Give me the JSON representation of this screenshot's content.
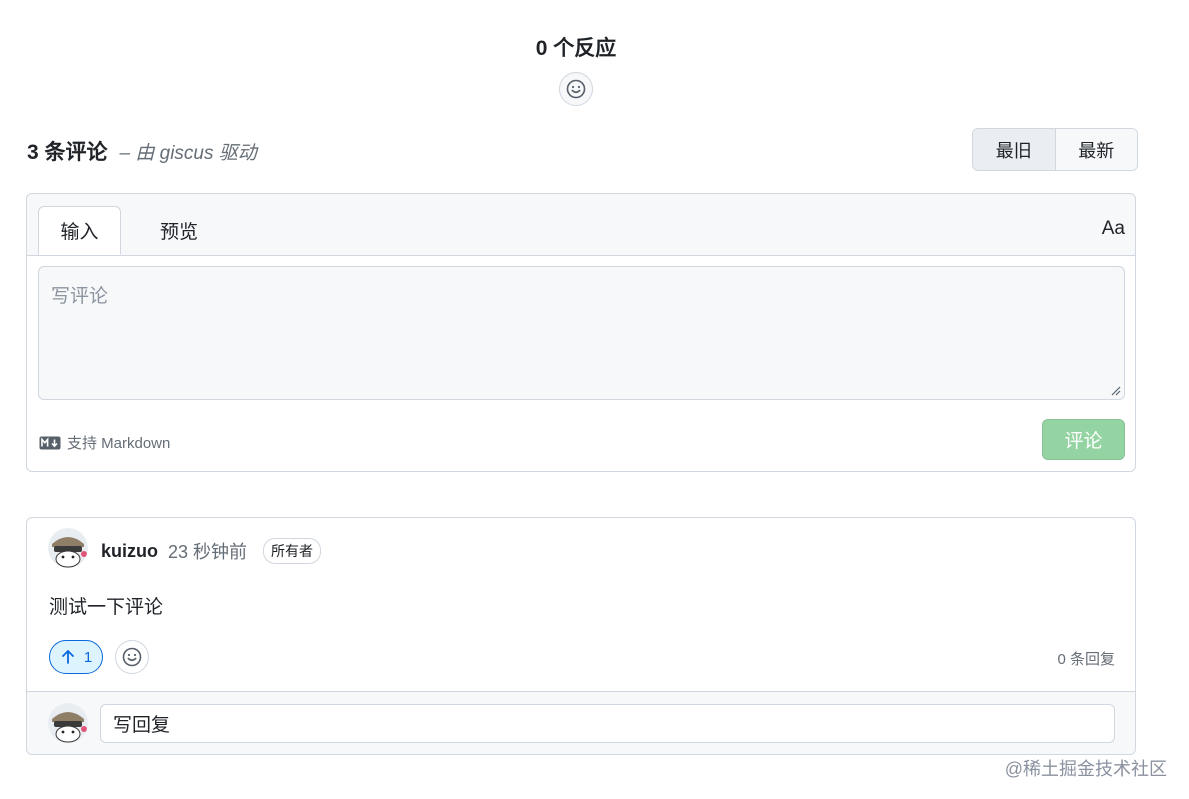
{
  "reactions": {
    "title": "0 个反应",
    "add_icon": "smiley-icon"
  },
  "comments_header": {
    "count_label": "3 条评论",
    "powered_by": "– 由 giscus 驱动"
  },
  "sort": {
    "oldest": "最旧",
    "newest": "最新",
    "active": "oldest"
  },
  "editor": {
    "tab_write": "输入",
    "tab_preview": "预览",
    "font_toggle": "Aa",
    "placeholder": "写评论",
    "markdown_note": "支持 Markdown",
    "submit_label": "评论",
    "submit_color": "#94d3a2"
  },
  "comment": {
    "author": "kuizuo",
    "time": "23 秒钟前",
    "badge": "所有者",
    "body": "测试一下评论",
    "upvotes": "1",
    "replies": "0 条回复",
    "reply_placeholder": "写回复"
  },
  "watermark": "@稀土掘金技术社区",
  "colors": {
    "accent_blue": "#0969da",
    "border": "#d0d7de",
    "muted": "#656d76"
  }
}
